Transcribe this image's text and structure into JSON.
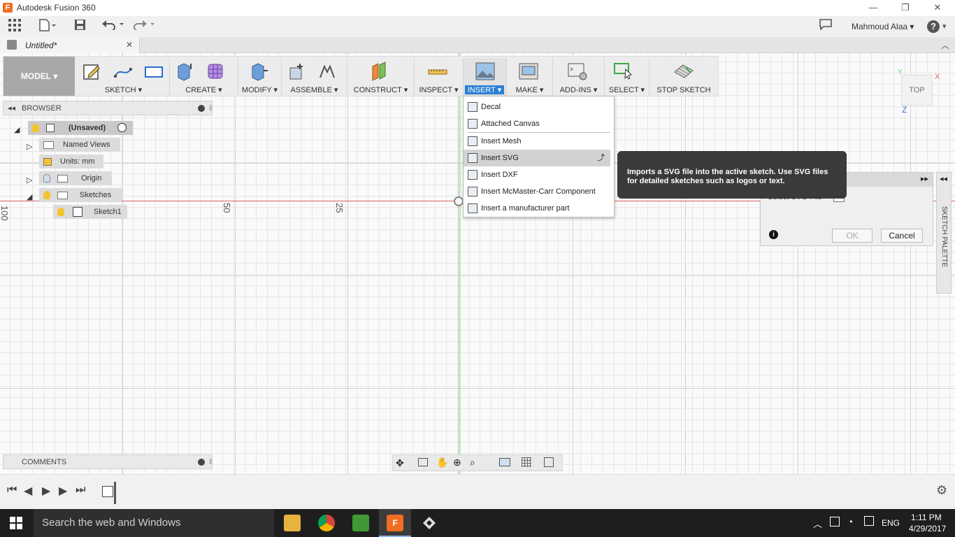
{
  "window": {
    "title": "Autodesk Fusion 360",
    "minimize": "—",
    "restore": "❐",
    "close": "✕"
  },
  "quick_access": {
    "user_name": "Mahmoud Alaa",
    "help": "?"
  },
  "document_tab": {
    "name": "Untitled*",
    "close": "✕"
  },
  "toolbar": {
    "workspace": "MODEL ▾",
    "groups": {
      "sketch": "SKETCH ▾",
      "create": "CREATE ▾",
      "modify": "MODIFY ▾",
      "assemble": "ASSEMBLE ▾",
      "construct": "CONSTRUCT ▾",
      "inspect": "INSPECT ▾",
      "insert": "INSERT ▾",
      "make": "MAKE ▾",
      "addins": "ADD-INS ▾",
      "select": "SELECT ▾",
      "stop_sketch": "STOP SKETCH"
    }
  },
  "browser": {
    "title": "BROWSER",
    "root": "(Unsaved)",
    "items": {
      "named_views": "Named Views",
      "units": "Units: mm",
      "origin": "Origin",
      "sketches": "Sketches",
      "sketch1": "Sketch1"
    }
  },
  "comments": {
    "title": "COMMENTS"
  },
  "insert_menu": {
    "items": [
      "Decal",
      "Attached Canvas",
      "Insert Mesh",
      "Insert SVG",
      "Insert DXF",
      "Insert McMaster-Carr Component",
      "Insert a manufacturer part"
    ]
  },
  "tooltip": {
    "text": "Imports a SVG file into the active sketch. Use SVG files for detailed sketches such as logos or text."
  },
  "dialog": {
    "field_label": "Select SVG File",
    "ok": "OK",
    "cancel": "Cancel",
    "info": "i"
  },
  "sketch_palette": {
    "label": "SKETCH PALETTE"
  },
  "viewcube": {
    "face": "TOP",
    "axis_x": "X",
    "axis_y": "Y",
    "axis_z": "Z"
  },
  "canvas": {
    "ruler": {
      "r100": "100",
      "r50": "50",
      "r25": "25"
    }
  },
  "taskbar": {
    "search_placeholder": "Search the web and Windows",
    "language": "ENG",
    "time": "1:11 PM",
    "date": "4/29/2017"
  },
  "colors": {
    "menu_selected": "#d2d2d2",
    "tooltip_bg": "#3a3a3a",
    "axis_red": "#e06060",
    "axis_green": "#6ccf6c",
    "insert_active": "#2a7fd4"
  }
}
